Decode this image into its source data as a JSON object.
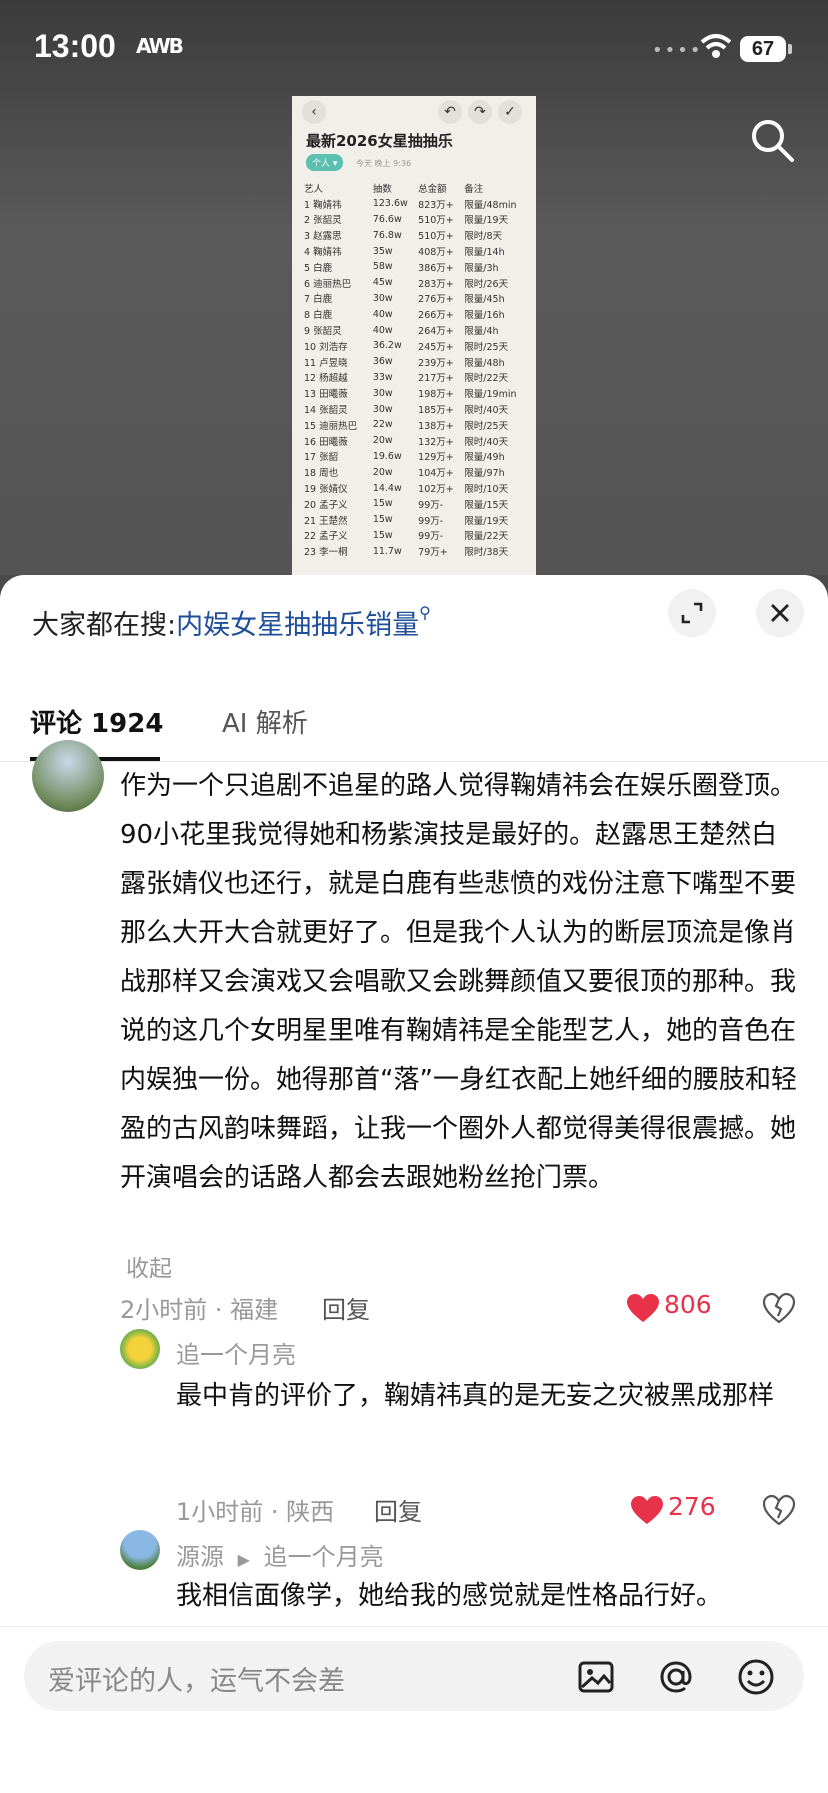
{
  "status_bar": {
    "time": "13:00",
    "carrier_glyph": "AWB",
    "battery": "67"
  },
  "doc": {
    "title": "最新2026女星抽抽乐",
    "tag": "个人 ▾",
    "meta": "今天 晚上 9:36",
    "headers": [
      "艺人",
      "抽数",
      "总金额",
      "备注"
    ],
    "rows": [
      [
        "1 鞠婧祎",
        "123.6w",
        "823万+",
        "限量/48min"
      ],
      [
        "2 张韶灵",
        "76.6w",
        "510万+",
        "限量/19天"
      ],
      [
        "3 赵露思",
        "76.8w",
        "510万+",
        "限时/8天"
      ],
      [
        "4 鞠婧祎",
        "35w",
        "408万+",
        "限量/14h"
      ],
      [
        "5 白鹿",
        "58w",
        "386万+",
        "限量/3h"
      ],
      [
        "6 迪丽热巴",
        "45w",
        "283万+",
        "限时/26天"
      ],
      [
        "7 白鹿",
        "30w",
        "276万+",
        "限量/45h"
      ],
      [
        "8 白鹿",
        "40w",
        "266万+",
        "限量/16h"
      ],
      [
        "9 张韶灵",
        "40w",
        "264万+",
        "限量/4h"
      ],
      [
        "10 刘浩存",
        "36.2w",
        "245万+",
        "限时/25天"
      ],
      [
        "11 卢昱晓",
        "36w",
        "239万+",
        "限量/48h"
      ],
      [
        "12 杨超越",
        "33w",
        "217万+",
        "限时/22天"
      ],
      [
        "13 田曦薇",
        "30w",
        "198万+",
        "限量/19min"
      ],
      [
        "14 张韶灵",
        "30w",
        "185万+",
        "限时/40天"
      ],
      [
        "15 迪丽热巴",
        "22w",
        "138万+",
        "限时/25天"
      ],
      [
        "16 田曦薇",
        "20w",
        "132万+",
        "限时/40天"
      ],
      [
        "17 张韶",
        "19.6w",
        "129万+",
        "限量/49h"
      ],
      [
        "18 周也",
        "20w",
        "104万+",
        "限量/97h"
      ],
      [
        "19 张婧仪",
        "14.4w",
        "102万+",
        "限时/10天"
      ],
      [
        "20 孟子义",
        "15w",
        "99万-",
        "限量/15天"
      ],
      [
        "21 王楚然",
        "15w",
        "99万-",
        "限量/19天"
      ],
      [
        "22 孟子义",
        "15w",
        "99万-",
        "限量/22天"
      ],
      [
        "23 李一桐",
        "11.7w",
        "79万+",
        "限时/38天"
      ]
    ]
  },
  "sheet": {
    "search_prefix": "大家都在搜:",
    "search_query": "内娱女星抽抽乐销量",
    "tabs": {
      "comments": "评论 1924",
      "ai": "AI 解析"
    }
  },
  "main_comment": {
    "text": "作为一个只追剧不追星的路人觉得鞠婧祎会在娱乐圈登顶。90小花里我觉得她和杨紫演技是最好的。赵露思王楚然白露张婧仪也还行，就是白鹿有些悲愤的戏份注意下嘴型不要那么大开大合就更好了。但是我个人认为的断层顶流是像肖战那样又会演戏又会唱歌又会跳舞颜值又要很顶的那种。我说的这几个女明星里唯有鞠婧祎是全能型艺人，她的音色在内娱独一份。她得那首“落”一身红衣配上她纤细的腰肢和轻盈的古风韵味舞蹈，让我一个圈外人都觉得美得很震撼。她开演唱会的话路人都会去跟她粉丝抢门票。",
    "collapse": "收起",
    "meta": "2小时前 · 福建",
    "reply": "回复",
    "likes": "806"
  },
  "reply1": {
    "name": "追一个月亮",
    "text": "最中肯的评价了，鞠婧祎真的是无妄之灾被黑成那样",
    "meta": "1小时前 · 陕西",
    "reply": "回复",
    "likes": "276"
  },
  "reply2": {
    "name": "源源",
    "target": "追一个月亮",
    "text": "我相信面像学，她给我的感觉就是性格品行好。"
  },
  "input": {
    "placeholder": "爱评论的人，运气不会差"
  }
}
